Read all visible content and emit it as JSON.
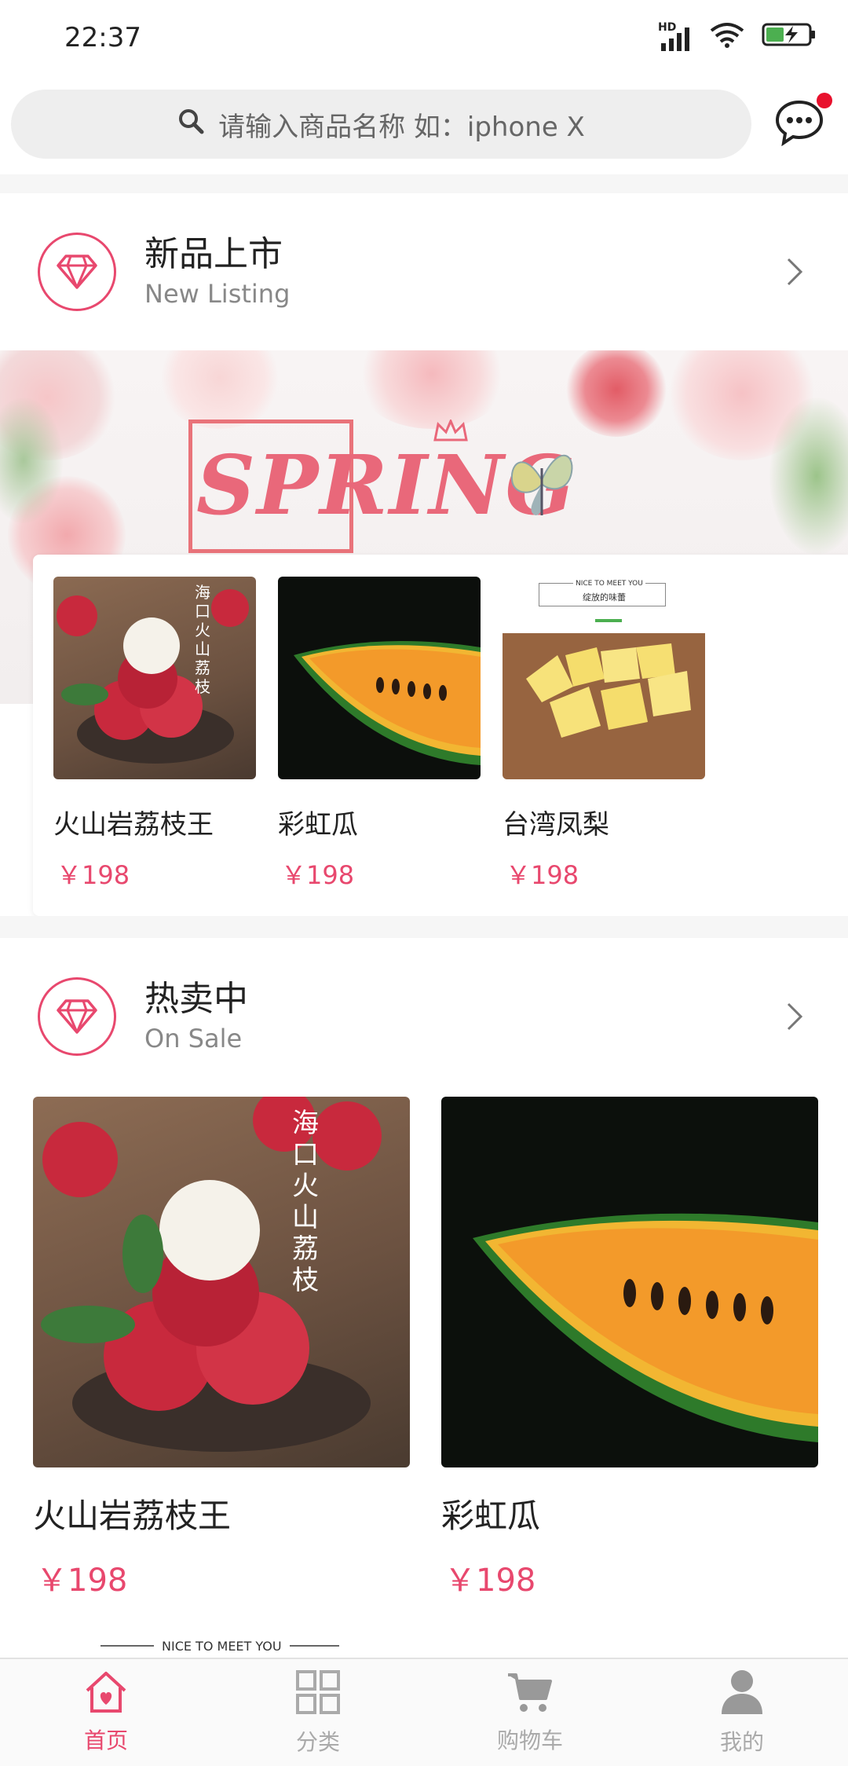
{
  "status_bar": {
    "time": "22:37",
    "network_badge": "HD"
  },
  "search": {
    "placeholder": "请输入商品名称  如：iphone  X"
  },
  "sections": {
    "new_listing": {
      "title": "新品上市",
      "subtitle": "New Listing"
    },
    "on_sale": {
      "title": "热卖中",
      "subtitle": "On Sale"
    }
  },
  "banner": {
    "text": "SPRING"
  },
  "new_items": [
    {
      "name": "火山岩荔枝王",
      "price": "￥198"
    },
    {
      "name": "彩虹瓜",
      "price": "￥198"
    },
    {
      "name": "台湾凤梨",
      "price": "￥198"
    }
  ],
  "image_texts": {
    "lychee": "海口火山荔枝",
    "pineapple_header": "NICE TO MEET YOU",
    "pineapple_sub": "绽放的味蕾",
    "peek": "NICE TO MEET YOU"
  },
  "hot_items": [
    {
      "name": "火山岩荔枝王",
      "price": "￥198"
    },
    {
      "name": "彩虹瓜",
      "price": "￥198"
    }
  ],
  "tabs": [
    {
      "label": "首页",
      "icon": "home-icon",
      "active": true
    },
    {
      "label": "分类",
      "icon": "grid-icon",
      "active": false
    },
    {
      "label": "购物车",
      "icon": "cart-icon",
      "active": false
    },
    {
      "label": "我的",
      "icon": "user-icon",
      "active": false
    }
  ],
  "colors": {
    "accent": "#e8486e",
    "notification": "#e8112d",
    "search_bg": "#eeeeee"
  }
}
